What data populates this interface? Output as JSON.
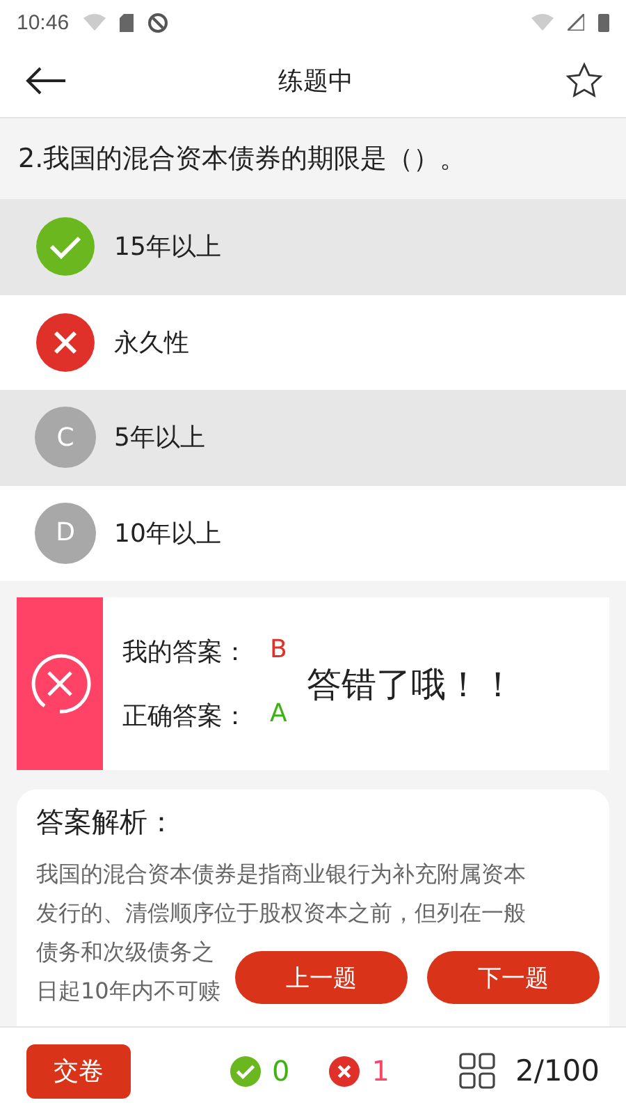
{
  "status_bar": {
    "time": "10:46"
  },
  "header": {
    "title": "练题中",
    "favorited": false
  },
  "question": "2.我国的混合资本债券的期限是（）。",
  "options": [
    {
      "kind": "correct",
      "text": "15年以上"
    },
    {
      "kind": "wrong",
      "text": "永久性"
    },
    {
      "kind": "lettered",
      "letter": "C",
      "text": "5年以上"
    },
    {
      "kind": "lettered",
      "letter": "D",
      "text": "10年以上"
    }
  ],
  "result": {
    "my_label": "我的答案：",
    "my_answer": "B",
    "correct_label": "正确答案：",
    "correct_answer": "A",
    "message": "答错了哦！！"
  },
  "analysis": {
    "title": "答案解析：",
    "lines": [
      "我国的混合资本债券是指商业银行为补充附属资本",
      "发行的、清偿顺序位于股权资本之前，但列在一般",
      "债务和次级债务之",
      "日起10年内不可赎"
    ]
  },
  "nav_buttons": [
    "上一题",
    "下一题"
  ],
  "bottom_bar": {
    "submit": "交卷",
    "correct_count": "0",
    "wrong_count": "1",
    "progress": "2/100"
  }
}
